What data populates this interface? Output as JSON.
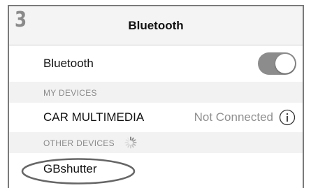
{
  "step_number": "3",
  "header": {
    "title": "Bluetooth"
  },
  "bluetooth_row": {
    "label": "Bluetooth",
    "toggle_on": true
  },
  "my_devices": {
    "section_label": "MY DEVICES",
    "items": [
      {
        "name": "CAR MULTIMEDIA",
        "status": "Not Connected",
        "icon": "info-icon"
      }
    ]
  },
  "other_devices": {
    "section_label": "OTHER DEVICES",
    "spinner_icon": "loading-spinner-icon",
    "items": [
      {
        "name": "GBshutter",
        "highlighted": true
      }
    ]
  },
  "colors": {
    "toggle_track": "#8c8c8c",
    "status_text": "#909090",
    "section_bg": "#f2f2f2",
    "highlight_ellipse": "#666666"
  }
}
